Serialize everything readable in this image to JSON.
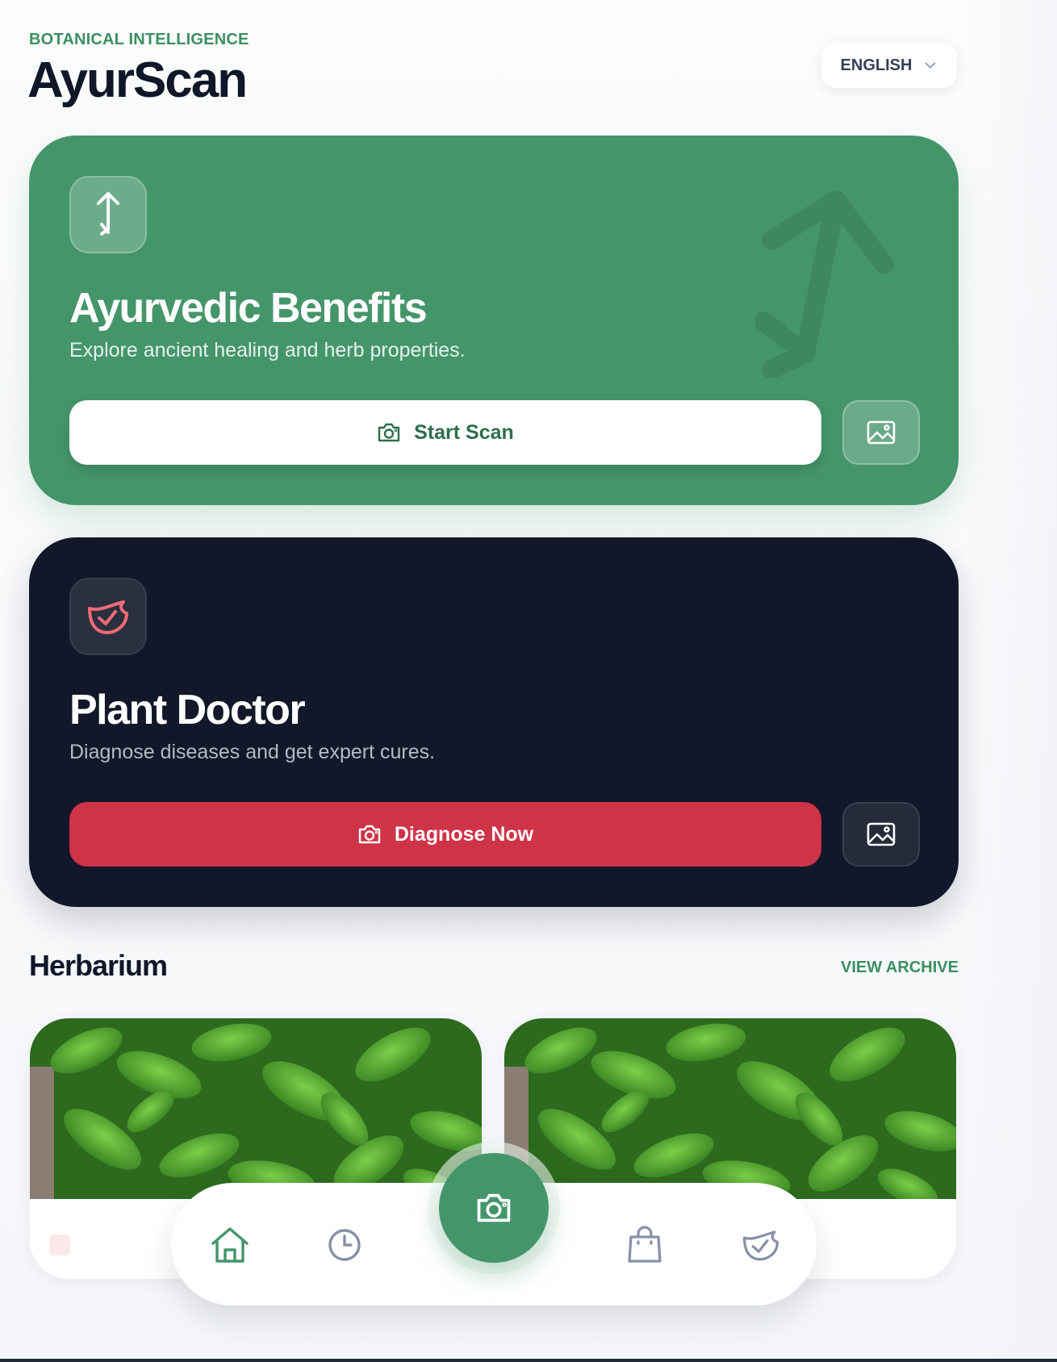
{
  "header": {
    "eyebrow": "BOTANICAL INTELLIGENCE",
    "app_title": "AyurScan",
    "language_selector": {
      "value": "ENGLISH",
      "icon": "chevron-down-icon"
    }
  },
  "cards": {
    "ayurvedic": {
      "title": "Ayurvedic Benefits",
      "subtitle": "Explore ancient healing and herb properties.",
      "primary_button": "Start Scan",
      "icon": "herb-sprout-icon",
      "accent": "#45956b"
    },
    "doctor": {
      "title": "Plant Doctor",
      "subtitle": "Diagnose diseases and get expert cures.",
      "primary_button": "Diagnose Now",
      "icon": "shield-check-icon",
      "accent": "#cf3347",
      "background": "#121729"
    }
  },
  "herbarium": {
    "title": "Herbarium",
    "view_all": "VIEW ARCHIVE"
  },
  "bottom_nav": {
    "items": [
      "home-icon",
      "history-clock-icon",
      "camera-icon",
      "shopping-bag-icon",
      "shield-check-icon"
    ],
    "active": "home-icon"
  }
}
